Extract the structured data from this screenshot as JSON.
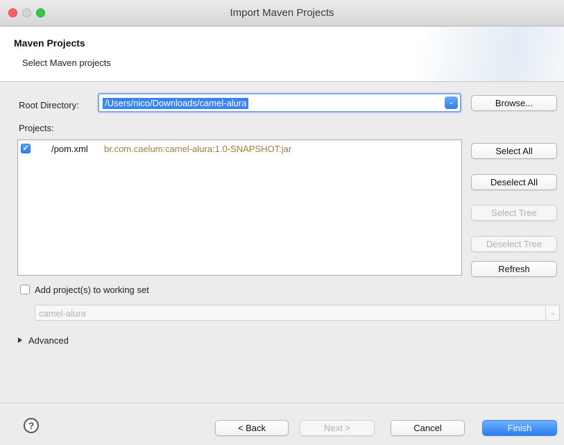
{
  "window": {
    "title": "Import Maven Projects"
  },
  "header": {
    "title": "Maven Projects",
    "subtitle": "Select Maven projects"
  },
  "root_directory": {
    "label": "Root Directory:",
    "value": "/Users/nico/Downloads/camel-alura",
    "browse_label": "Browse..."
  },
  "projects": {
    "label": "Projects:",
    "items": [
      {
        "checked": true,
        "name": "/pom.xml",
        "artifact": "br.com.caelum:camel-alura:1.0-SNAPSHOT:jar"
      }
    ]
  },
  "side_buttons": {
    "select_all": "Select All",
    "deselect_all": "Deselect All",
    "select_tree": "Select Tree",
    "deselect_tree": "Deselect Tree",
    "refresh": "Refresh"
  },
  "working_set": {
    "label": "Add project(s) to working set",
    "checked": false,
    "value": "camel-alura"
  },
  "advanced": {
    "label": "Advanced"
  },
  "footer": {
    "help": "?",
    "back": "< Back",
    "next": "Next >",
    "cancel": "Cancel",
    "finish": "Finish"
  },
  "colors": {
    "accent": "#2a7ef0",
    "artifact_text": "#a27c3a"
  }
}
